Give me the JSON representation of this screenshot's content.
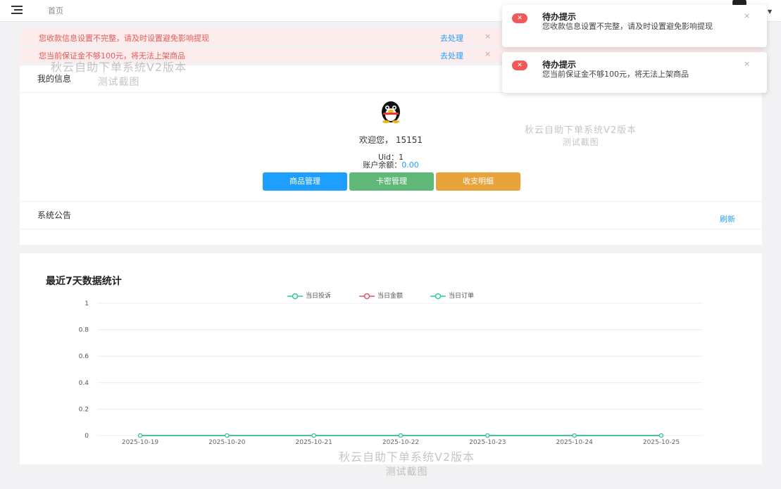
{
  "header": {
    "breadcrumb": "首页",
    "menu_icon": "menu-icon",
    "user_icon": "user-avatar-icon",
    "caret_icon": "chevron-down-icon"
  },
  "alerts": [
    {
      "message": "您收款信息设置不完整，请及时设置避免影响提现",
      "action": "去处理",
      "close": "×"
    },
    {
      "message": "您当前保证金不够100元，将无法上架商品",
      "action": "去处理",
      "close": "×"
    }
  ],
  "toasts": [
    {
      "title": "待办提示",
      "body": "您收款信息设置不完整，请及时设置避免影响提现",
      "close": "×",
      "icon": "error-icon"
    },
    {
      "title": "待办提示",
      "body": "您当前保证金不够100元，将无法上架商品",
      "close": "×",
      "icon": "error-icon"
    }
  ],
  "profile": {
    "title": "我的信息",
    "avatar_icon": "qq-penguin-icon",
    "welcome": "欢迎您， 15151",
    "uid": "Uid：1",
    "balance_label": "账户余额：",
    "balance_value": "0.00",
    "buttons": [
      {
        "label": "商品管理",
        "color": "#1e9fff"
      },
      {
        "label": "卡密管理",
        "color": "#5fb878"
      },
      {
        "label": "收支明细",
        "color": "#e8a33d"
      }
    ]
  },
  "notice": {
    "title": "系统公告",
    "refresh": "刷新"
  },
  "stats": {
    "title": "最近7天数据统计"
  },
  "watermark": {
    "line1": "秋云自助下单系统V2版本",
    "line2": "测试截图"
  },
  "chart_data": {
    "type": "line",
    "x": [
      "2025-10-19",
      "2025-10-20",
      "2025-10-21",
      "2025-10-22",
      "2025-10-23",
      "2025-10-24",
      "2025-10-25"
    ],
    "series": [
      {
        "name": "当日投诉",
        "values": [
          0,
          0,
          0,
          0,
          0,
          0,
          0
        ],
        "color": "#2ec7a1"
      },
      {
        "name": "当日金额",
        "values": [
          0,
          0,
          0,
          0,
          0,
          0,
          0
        ],
        "color": "#e0526a"
      },
      {
        "name": "当日订单",
        "values": [
          0,
          0,
          0,
          0,
          0,
          0,
          0
        ],
        "color": "#2ec7a1"
      }
    ],
    "ylim": [
      0,
      1
    ],
    "yticks": [
      "0",
      "0.2",
      "0.4",
      "0.6",
      "0.8",
      "1"
    ],
    "grid": true,
    "legend": "top-center"
  }
}
